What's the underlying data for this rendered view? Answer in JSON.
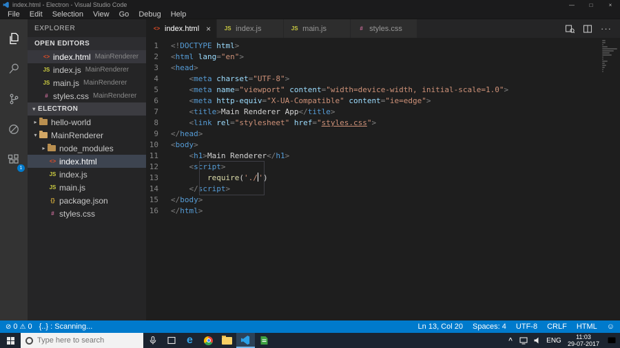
{
  "window": {
    "title": "index.html - Electron - Visual Studio Code",
    "menus": [
      "File",
      "Edit",
      "Selection",
      "View",
      "Go",
      "Debug",
      "Help"
    ],
    "controls": {
      "minimize": "—",
      "restore": "□",
      "close": "×"
    }
  },
  "activity_bar": {
    "items": [
      "explorer",
      "search",
      "source-control",
      "debug",
      "extensions"
    ],
    "active": "explorer",
    "extensions_badge": "1"
  },
  "sidebar": {
    "title": "EXPLORER",
    "open_editors": {
      "label": "OPEN EDITORS",
      "items": [
        {
          "name": "index.html",
          "detail": "MainRenderer",
          "icon": "html",
          "active": true
        },
        {
          "name": "index.js",
          "detail": "MainRenderer",
          "icon": "js",
          "active": false
        },
        {
          "name": "main.js",
          "detail": "MainRenderer",
          "icon": "js",
          "active": false
        },
        {
          "name": "styles.css",
          "detail": "MainRenderer",
          "icon": "css",
          "active": false
        }
      ]
    },
    "tree": {
      "label": "ELECTRON",
      "items": [
        {
          "name": "hello-world",
          "kind": "folder",
          "depth": 0,
          "expanded": false,
          "selected": false
        },
        {
          "name": "MainRenderer",
          "kind": "folder",
          "depth": 0,
          "expanded": true,
          "selected": false
        },
        {
          "name": "node_modules",
          "kind": "folder",
          "depth": 1,
          "expanded": false,
          "selected": false
        },
        {
          "name": "index.html",
          "kind": "file",
          "icon": "html",
          "depth": 1,
          "selected": true
        },
        {
          "name": "index.js",
          "kind": "file",
          "icon": "js",
          "depth": 1,
          "selected": false
        },
        {
          "name": "main.js",
          "kind": "file",
          "icon": "js",
          "depth": 1,
          "selected": false
        },
        {
          "name": "package.json",
          "kind": "file",
          "icon": "json",
          "depth": 1,
          "selected": false
        },
        {
          "name": "styles.css",
          "kind": "file",
          "icon": "css",
          "depth": 1,
          "selected": false
        }
      ]
    }
  },
  "tabs": [
    {
      "label": "index.html",
      "icon": "html",
      "active": true
    },
    {
      "label": "index.js",
      "icon": "js",
      "active": false
    },
    {
      "label": "main.js",
      "icon": "js",
      "active": false
    },
    {
      "label": "styles.css",
      "icon": "css",
      "active": false
    }
  ],
  "editor": {
    "lines": [
      [
        [
          "p",
          "<!"
        ],
        [
          "t",
          "DOCTYPE"
        ],
        [
          "a",
          " html"
        ],
        [
          "p",
          ">"
        ]
      ],
      [
        [
          "p",
          "<"
        ],
        [
          "t",
          "html"
        ],
        [
          "a",
          " lang"
        ],
        [
          "p",
          "="
        ],
        [
          "s",
          "\"en\""
        ],
        [
          "p",
          ">"
        ]
      ],
      [
        [
          "p",
          "<"
        ],
        [
          "t",
          "head"
        ],
        [
          "p",
          ">"
        ]
      ],
      [
        [
          "x",
          "    "
        ],
        [
          "p",
          "<"
        ],
        [
          "t",
          "meta"
        ],
        [
          "a",
          " charset"
        ],
        [
          "p",
          "="
        ],
        [
          "s",
          "\"UTF-8\""
        ],
        [
          "p",
          ">"
        ]
      ],
      [
        [
          "x",
          "    "
        ],
        [
          "p",
          "<"
        ],
        [
          "t",
          "meta"
        ],
        [
          "a",
          " name"
        ],
        [
          "p",
          "="
        ],
        [
          "s",
          "\"viewport\""
        ],
        [
          "a",
          " content"
        ],
        [
          "p",
          "="
        ],
        [
          "s",
          "\"width=device-width, initial-scale=1.0\""
        ],
        [
          "p",
          ">"
        ]
      ],
      [
        [
          "x",
          "    "
        ],
        [
          "p",
          "<"
        ],
        [
          "t",
          "meta"
        ],
        [
          "a",
          " http-equiv"
        ],
        [
          "p",
          "="
        ],
        [
          "s",
          "\"X-UA-Compatible\""
        ],
        [
          "a",
          " content"
        ],
        [
          "p",
          "="
        ],
        [
          "s",
          "\"ie=edge\""
        ],
        [
          "p",
          ">"
        ]
      ],
      [
        [
          "x",
          "    "
        ],
        [
          "p",
          "<"
        ],
        [
          "t",
          "title"
        ],
        [
          "p",
          ">"
        ],
        [
          "x",
          "Main Renderer App"
        ],
        [
          "p",
          "</"
        ],
        [
          "t",
          "title"
        ],
        [
          "p",
          ">"
        ]
      ],
      [
        [
          "x",
          "    "
        ],
        [
          "p",
          "<"
        ],
        [
          "t",
          "link"
        ],
        [
          "a",
          " rel"
        ],
        [
          "p",
          "="
        ],
        [
          "s",
          "\"stylesheet\""
        ],
        [
          "a",
          " href"
        ],
        [
          "p",
          "="
        ],
        [
          "s",
          "\""
        ],
        [
          "u",
          "styles.css"
        ],
        [
          "s",
          "\""
        ],
        [
          "p",
          ">"
        ]
      ],
      [
        [
          "p",
          "</"
        ],
        [
          "t",
          "head"
        ],
        [
          "p",
          ">"
        ]
      ],
      [
        [
          "p",
          "<"
        ],
        [
          "t",
          "body"
        ],
        [
          "p",
          ">"
        ]
      ],
      [
        [
          "x",
          "    "
        ],
        [
          "p",
          "<"
        ],
        [
          "t",
          "h1"
        ],
        [
          "p",
          ">"
        ],
        [
          "x",
          "Main Renderer"
        ],
        [
          "p",
          "</"
        ],
        [
          "t",
          "h1"
        ],
        [
          "p",
          ">"
        ]
      ],
      [
        [
          "x",
          "    "
        ],
        [
          "p",
          "<"
        ],
        [
          "t",
          "script"
        ],
        [
          "p",
          ">"
        ]
      ],
      [
        [
          "x",
          "        "
        ],
        [
          "f",
          "require"
        ],
        [
          "x",
          "("
        ],
        [
          "s",
          "'./"
        ],
        [
          "c",
          ""
        ],
        [
          "s",
          "'"
        ],
        [
          "x",
          ")"
        ]
      ],
      [
        [
          "x",
          "    "
        ],
        [
          "p",
          "</"
        ],
        [
          "t",
          "script"
        ],
        [
          "p",
          ">"
        ]
      ],
      [
        [
          "p",
          "</"
        ],
        [
          "t",
          "body"
        ],
        [
          "p",
          ">"
        ]
      ],
      [
        [
          "p",
          "</"
        ],
        [
          "t",
          "html"
        ],
        [
          "p",
          ">"
        ]
      ]
    ]
  },
  "status_bar": {
    "errors": "0",
    "warnings": "0",
    "message": "{..} : Scanning...",
    "line_col": "Ln 13, Col 20",
    "indent": "Spaces: 4",
    "encoding": "UTF-8",
    "eol": "CRLF",
    "language": "HTML"
  },
  "taskbar": {
    "search_placeholder": "Type here to search",
    "apps": [
      "edge",
      "chrome",
      "file-explorer",
      "vscode",
      "green-app"
    ],
    "active_app": "vscode",
    "tray": {
      "lang": "ENG",
      "time": "11:03",
      "date": "29-07-2017"
    }
  }
}
